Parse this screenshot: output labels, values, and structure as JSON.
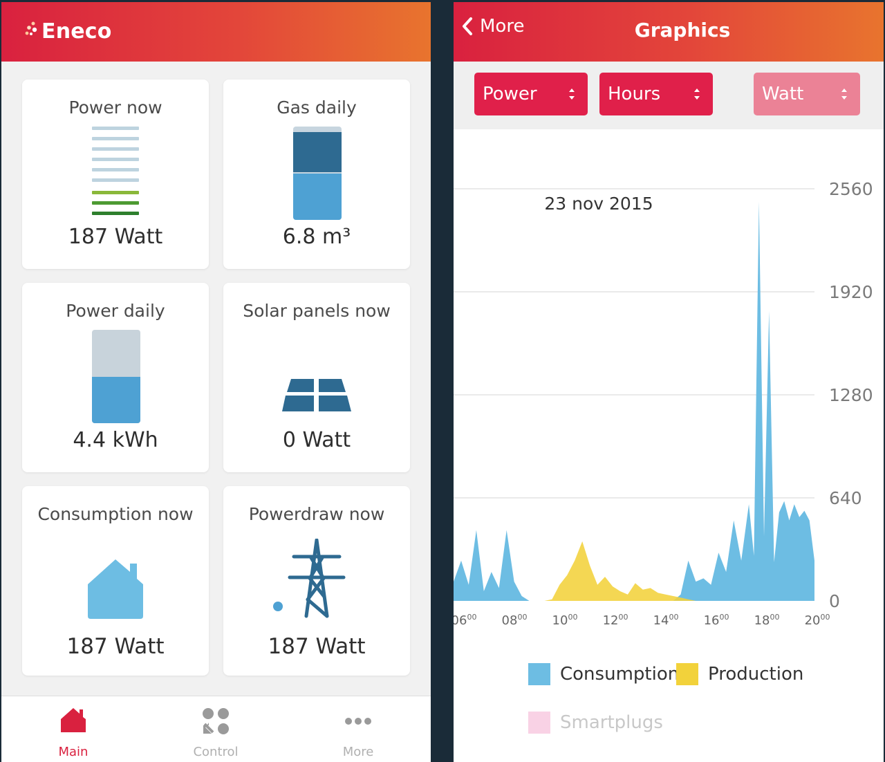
{
  "left": {
    "brand": "Eneco",
    "tiles": [
      {
        "title": "Power now",
        "value": "187 Watt"
      },
      {
        "title": "Gas daily",
        "value": "6.8 m³"
      },
      {
        "title": "Power daily",
        "value": "4.4 kWh"
      },
      {
        "title": "Solar panels now",
        "value": "0 Watt"
      },
      {
        "title": "Consumption now",
        "value": "187 Watt"
      },
      {
        "title": "Powerdraw now",
        "value": "187 Watt"
      }
    ],
    "nav": [
      {
        "label": "Main",
        "icon": "house-icon",
        "active": true
      },
      {
        "label": "Control",
        "icon": "control-icon",
        "active": false
      },
      {
        "label": "More",
        "icon": "more-dots-icon",
        "active": false
      }
    ],
    "colors": {
      "accent": "#d9213f",
      "tile_blue": "#4ea1d3",
      "tile_dark": "#2e6a91",
      "green": "#5a9a2a"
    }
  },
  "right": {
    "back_label": "More",
    "title": "Graphics",
    "selects": [
      {
        "label": "Power",
        "enabled": true
      },
      {
        "label": "Hours",
        "enabled": true
      },
      {
        "label": "Watt",
        "enabled": false
      }
    ],
    "legend": [
      {
        "label": "Consumption",
        "color": "#6dbde3"
      },
      {
        "label": "Production",
        "color": "#f2d23b"
      },
      {
        "label": "Smartplugs",
        "color": "#f9d2e5"
      }
    ]
  },
  "chart_data": {
    "type": "area",
    "title": "23 nov 2015",
    "xlabel": "",
    "ylabel": "",
    "ylim": [
      0,
      2560
    ],
    "yticks": [
      "2560",
      "1920",
      "1280",
      "640",
      "0"
    ],
    "xticks": [
      {
        "h": "06",
        "m": "00"
      },
      {
        "h": "08",
        "m": "00"
      },
      {
        "h": "10",
        "m": "00"
      },
      {
        "h": "12",
        "m": "00"
      },
      {
        "h": "14",
        "m": "00"
      },
      {
        "h": "16",
        "m": "00"
      },
      {
        "h": "18",
        "m": "00"
      },
      {
        "h": "20",
        "m": "00"
      }
    ],
    "x_hours": [
      6,
      6.3,
      6.6,
      6.9,
      7.2,
      7.5,
      7.8,
      8.1,
      8.4,
      8.7,
      9,
      9.3,
      9.6,
      9.9,
      10.2,
      10.5,
      10.8,
      11.1,
      11.4,
      11.7,
      12,
      12.3,
      12.6,
      12.9,
      13.2,
      13.5,
      13.8,
      14.1,
      14.4,
      14.7,
      15,
      15.3,
      15.6,
      15.9,
      16.2,
      16.5,
      16.8,
      17.1,
      17.4,
      17.7,
      17.9,
      18.1,
      18.3,
      18.5,
      18.7,
      18.9,
      19.1,
      19.3,
      19.5,
      19.7,
      19.9,
      20.1,
      20.3
    ],
    "series": [
      {
        "name": "Consumption",
        "values": [
          120,
          250,
          100,
          440,
          60,
          180,
          80,
          440,
          120,
          30,
          0,
          0,
          0,
          0,
          0,
          0,
          0,
          0,
          0,
          0,
          0,
          0,
          0,
          0,
          0,
          0,
          0,
          0,
          0,
          0,
          40,
          250,
          120,
          140,
          100,
          300,
          180,
          500,
          250,
          600,
          280,
          2480,
          400,
          1800,
          240,
          550,
          620,
          500,
          600,
          520,
          560,
          500,
          250
        ]
      },
      {
        "name": "Production",
        "values": [
          0,
          0,
          0,
          0,
          0,
          0,
          0,
          0,
          0,
          0,
          0,
          0,
          0,
          10,
          100,
          160,
          250,
          370,
          220,
          100,
          150,
          90,
          60,
          40,
          110,
          70,
          80,
          50,
          40,
          30,
          20,
          10,
          0,
          0,
          0,
          0,
          0,
          0,
          0,
          0,
          0,
          0,
          0,
          0,
          0,
          0,
          0,
          0,
          0,
          0,
          0,
          0,
          0
        ]
      }
    ]
  }
}
